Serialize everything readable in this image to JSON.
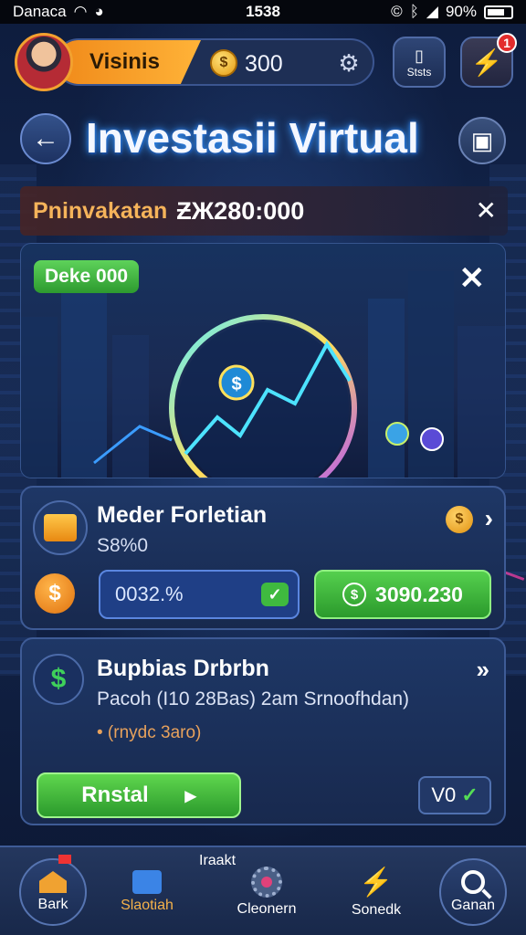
{
  "statusbar": {
    "carrier": "Danaca",
    "time": "1538",
    "battery": "90%"
  },
  "header": {
    "player_name": "Visinis",
    "coin_symbol": "$",
    "coins": "300",
    "stats_label": "Ststs",
    "notification_count": "1"
  },
  "title": {
    "text": "Investasii Virtual"
  },
  "banner": {
    "label": "Pninvakatan",
    "value": "ƵЖ280:000"
  },
  "hero": {
    "tag": "Deke 000"
  },
  "portfolio_card": {
    "title": "Meder Forletian",
    "subtitle": "S8%0",
    "percent_value": "0032.%",
    "amount": "3090.230"
  },
  "invest_card": {
    "title": "Bupbias Drbrbn",
    "line": "Pacoh (I10 28Bas) 2am Srnoofhdan)",
    "note": "• (rnydc 3aro)",
    "confirm_label": "Rnstal",
    "chip_label": "V0"
  },
  "bottomnav": {
    "market_tag": "Iraakt",
    "items": [
      {
        "label": "Bark"
      },
      {
        "label": "Slaotiah"
      },
      {
        "label": "Cleonern"
      },
      {
        "label": "Sonedk"
      },
      {
        "label": "Ganan"
      }
    ]
  },
  "colors": {
    "accent_orange": "#f08a1a",
    "accent_green": "#3fba3f",
    "background": "#0b1630",
    "panel": "#1e3766"
  }
}
